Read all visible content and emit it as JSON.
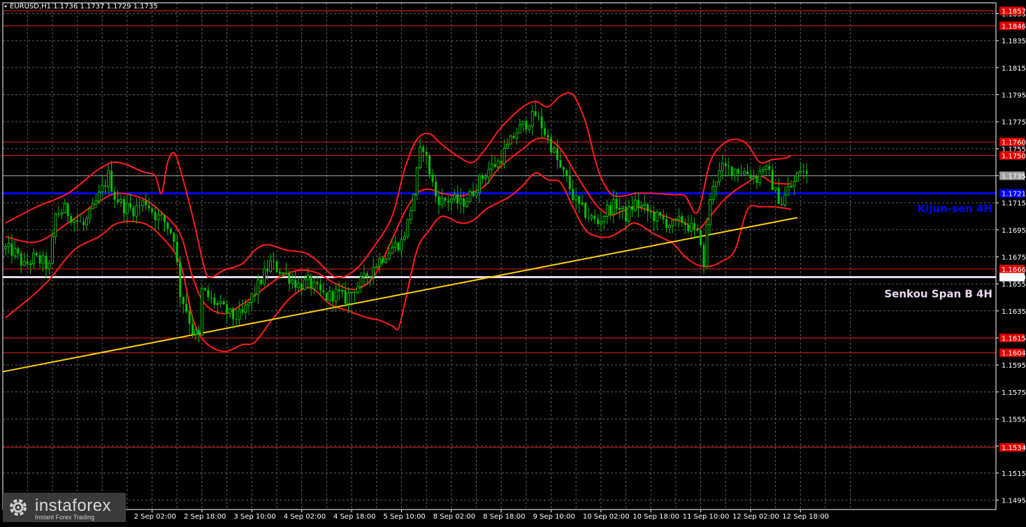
{
  "header": {
    "symbol_line": "EURUSD,H1  1.1736 1.1737 1.1729 1.1735"
  },
  "colors": {
    "background": "#000000",
    "grid": "#606060",
    "candle": "#00c000",
    "level_red": "#e02020",
    "kijun": "#0000ff",
    "senkou": "#e8d8f0",
    "trend": "#ffd000",
    "bands": "#ff1c1c",
    "badge": "#e00000",
    "badge_blue": "#0000ff",
    "badge_gray": "#a0a0a0"
  },
  "logo": {
    "name": "instaforex",
    "tagline": "Instant Forex Trading",
    "icon": "gear-icon"
  },
  "chart_data": {
    "type": "candlestick",
    "symbol": "EURUSD",
    "timeframe": "H1",
    "ohlc_current": {
      "open": 1.1736,
      "high": 1.1737,
      "low": 1.1729,
      "close": 1.1735
    },
    "ylim": [
      1.1488,
      1.1863
    ],
    "y_ticks": [
      "1.1855",
      "1.1835",
      "1.1815",
      "1.1795",
      "1.1775",
      "1.1755",
      "1.1735",
      "1.1715",
      "1.1695",
      "1.1675",
      "1.1655",
      "1.1635",
      "1.1615",
      "1.1595",
      "1.1575",
      "1.1555",
      "1.1535",
      "1.1515",
      "1.1495"
    ],
    "x_ticks": [
      {
        "label": "2 Sep 02:00",
        "bar": 47
      },
      {
        "label": "2 Sep 18:00",
        "bar": 63
      },
      {
        "label": "3 Sep 10:00",
        "bar": 79
      },
      {
        "label": "4 Sep 02:00",
        "bar": 95
      },
      {
        "label": "4 Sep 18:00",
        "bar": 111
      },
      {
        "label": "5 Sep 10:00",
        "bar": 127
      },
      {
        "label": "8 Sep 02:00",
        "bar": 143
      },
      {
        "label": "8 Sep 18:00",
        "bar": 159
      },
      {
        "label": "9 Sep 10:00",
        "bar": 175
      },
      {
        "label": "10 Sep 02:00",
        "bar": 191
      },
      {
        "label": "10 Sep 18:00",
        "bar": 207
      },
      {
        "label": "11 Sep 10:00",
        "bar": 223
      },
      {
        "label": "12 Sep 02:00",
        "bar": 239
      },
      {
        "label": "12 Sep 18:00",
        "bar": 255
      }
    ],
    "bar_count": 258,
    "close_path": [
      [
        0,
        1.1681
      ],
      [
        3,
        1.1678
      ],
      [
        6,
        1.1668
      ],
      [
        9,
        1.1674
      ],
      [
        12,
        1.1671
      ],
      [
        14,
        1.1667
      ],
      [
        16,
        1.1706
      ],
      [
        19,
        1.171
      ],
      [
        22,
        1.1703
      ],
      [
        25,
        1.1698
      ],
      [
        28,
        1.171
      ],
      [
        31,
        1.1725
      ],
      [
        33,
        1.1735
      ],
      [
        35,
        1.172
      ],
      [
        38,
        1.1712
      ],
      [
        41,
        1.171
      ],
      [
        45,
        1.1716
      ],
      [
        48,
        1.1706
      ],
      [
        51,
        1.1701
      ],
      [
        54,
        1.169
      ],
      [
        56,
        1.1648
      ],
      [
        58,
        1.1636
      ],
      [
        60,
        1.162
      ],
      [
        62,
        1.1615
      ],
      [
        63,
        1.165
      ],
      [
        66,
        1.1643
      ],
      [
        70,
        1.1636
      ],
      [
        73,
        1.163
      ],
      [
        76,
        1.1632
      ],
      [
        79,
        1.1645
      ],
      [
        82,
        1.1658
      ],
      [
        85,
        1.167
      ],
      [
        88,
        1.1665
      ],
      [
        91,
        1.166
      ],
      [
        94,
        1.1654
      ],
      [
        97,
        1.1656
      ],
      [
        100,
        1.165
      ],
      [
        103,
        1.1645
      ],
      [
        106,
        1.1648
      ],
      [
        109,
        1.1644
      ],
      [
        112,
        1.1652
      ],
      [
        115,
        1.1658
      ],
      [
        118,
        1.1668
      ],
      [
        121,
        1.1675
      ],
      [
        124,
        1.1682
      ],
      [
        127,
        1.1686
      ],
      [
        129,
        1.17
      ],
      [
        131,
        1.1722
      ],
      [
        133,
        1.1752
      ],
      [
        134,
        1.1757
      ],
      [
        136,
        1.1738
      ],
      [
        138,
        1.172
      ],
      [
        140,
        1.1716
      ],
      [
        143,
        1.1718
      ],
      [
        146,
        1.1714
      ],
      [
        149,
        1.172
      ],
      [
        152,
        1.1731
      ],
      [
        155,
        1.174
      ],
      [
        158,
        1.1745
      ],
      [
        161,
        1.1756
      ],
      [
        164,
        1.1768
      ],
      [
        167,
        1.1774
      ],
      [
        170,
        1.178
      ],
      [
        172,
        1.1772
      ],
      [
        174,
        1.1762
      ],
      [
        176,
        1.1752
      ],
      [
        178,
        1.174
      ],
      [
        180,
        1.1732
      ],
      [
        182,
        1.172
      ],
      [
        184,
        1.1712
      ],
      [
        187,
        1.1705
      ],
      [
        190,
        1.17
      ],
      [
        193,
        1.171
      ],
      [
        196,
        1.1714
      ],
      [
        199,
        1.1705
      ],
      [
        202,
        1.1715
      ],
      [
        205,
        1.171
      ],
      [
        208,
        1.1705
      ],
      [
        211,
        1.1702
      ],
      [
        214,
        1.1698
      ],
      [
        217,
        1.1702
      ],
      [
        220,
        1.1696
      ],
      [
        223,
        1.1688
      ],
      [
        224,
        1.1665
      ],
      [
        225,
        1.17
      ],
      [
        227,
        1.173
      ],
      [
        230,
        1.174
      ],
      [
        234,
        1.174
      ],
      [
        238,
        1.1737
      ],
      [
        241,
        1.1733
      ],
      [
        243,
        1.1742
      ],
      [
        245,
        1.1735
      ],
      [
        247,
        1.1722
      ],
      [
        249,
        1.1715
      ],
      [
        251,
        1.1725
      ],
      [
        253,
        1.173
      ],
      [
        255,
        1.174
      ],
      [
        257,
        1.1735
      ]
    ],
    "levels": [
      {
        "value": 1.1857,
        "label": "1.1857"
      },
      {
        "value": 1.1846,
        "label": "1.1846"
      },
      {
        "value": 1.176,
        "label": "1.1760"
      },
      {
        "value": 1.175,
        "label": "1.1750"
      },
      {
        "value": 1.1666,
        "label": "1.1666"
      },
      {
        "value": 1.1615,
        "label": "1.1615"
      },
      {
        "value": 1.1604,
        "label": "1.1604"
      },
      {
        "value": 1.1534,
        "label": "1.1534"
      }
    ],
    "kijun": {
      "value": 1.1722,
      "label": "1.1721",
      "name": "Kijun-sen 4H"
    },
    "senkou": {
      "value": 1.166,
      "label": "1.1660",
      "name": "Senkou Span B 4H"
    },
    "current_price": {
      "value": 1.1735,
      "label": "1.1735"
    },
    "trend_line": {
      "from": [
        0,
        1.159
      ],
      "to": [
        254,
        1.1704
      ]
    },
    "bollinger_upper": [
      [
        0,
        1.17
      ],
      [
        10,
        1.1712
      ],
      [
        20,
        1.1722
      ],
      [
        30,
        1.174
      ],
      [
        36,
        1.1745
      ],
      [
        44,
        1.1738
      ],
      [
        48,
        1.1735
      ],
      [
        50,
        1.1722
      ],
      [
        52,
        1.1745
      ],
      [
        54,
        1.1752
      ],
      [
        56,
        1.174
      ],
      [
        60,
        1.1705
      ],
      [
        64,
        1.1665
      ],
      [
        66,
        1.166
      ],
      [
        70,
        1.1665
      ],
      [
        76,
        1.167
      ],
      [
        80,
        1.168
      ],
      [
        84,
        1.1684
      ],
      [
        90,
        1.168
      ],
      [
        96,
        1.1678
      ],
      [
        100,
        1.1672
      ],
      [
        106,
        1.166
      ],
      [
        112,
        1.1665
      ],
      [
        118,
        1.1682
      ],
      [
        124,
        1.1705
      ],
      [
        128,
        1.174
      ],
      [
        132,
        1.1762
      ],
      [
        136,
        1.1766
      ],
      [
        140,
        1.1758
      ],
      [
        146,
        1.1748
      ],
      [
        150,
        1.1745
      ],
      [
        154,
        1.1755
      ],
      [
        158,
        1.1768
      ],
      [
        162,
        1.1778
      ],
      [
        166,
        1.1786
      ],
      [
        170,
        1.179
      ],
      [
        174,
        1.1786
      ],
      [
        178,
        1.1794
      ],
      [
        182,
        1.1795
      ],
      [
        186,
        1.1775
      ],
      [
        190,
        1.174
      ],
      [
        194,
        1.1722
      ],
      [
        198,
        1.172
      ],
      [
        202,
        1.1722
      ],
      [
        208,
        1.1722
      ],
      [
        214,
        1.1721
      ],
      [
        218,
        1.172
      ],
      [
        222,
        1.1708
      ],
      [
        226,
        1.1745
      ],
      [
        230,
        1.1758
      ],
      [
        234,
        1.1762
      ],
      [
        238,
        1.1758
      ],
      [
        242,
        1.1745
      ],
      [
        246,
        1.1747
      ],
      [
        250,
        1.1748
      ],
      [
        252,
        1.175
      ]
    ],
    "bollinger_middle": [
      [
        0,
        1.169
      ],
      [
        10,
        1.1686
      ],
      [
        20,
        1.17
      ],
      [
        30,
        1.1716
      ],
      [
        36,
        1.1722
      ],
      [
        44,
        1.1718
      ],
      [
        50,
        1.1708
      ],
      [
        56,
        1.1692
      ],
      [
        60,
        1.166
      ],
      [
        64,
        1.164
      ],
      [
        70,
        1.1633
      ],
      [
        76,
        1.164
      ],
      [
        82,
        1.165
      ],
      [
        88,
        1.166
      ],
      [
        94,
        1.1665
      ],
      [
        100,
        1.1663
      ],
      [
        106,
        1.1655
      ],
      [
        112,
        1.1651
      ],
      [
        118,
        1.166
      ],
      [
        124,
        1.1688
      ],
      [
        128,
        1.1708
      ],
      [
        132,
        1.1722
      ],
      [
        136,
        1.1725
      ],
      [
        140,
        1.1722
      ],
      [
        146,
        1.172
      ],
      [
        150,
        1.1723
      ],
      [
        154,
        1.1728
      ],
      [
        158,
        1.174
      ],
      [
        162,
        1.1748
      ],
      [
        166,
        1.1755
      ],
      [
        170,
        1.1762
      ],
      [
        174,
        1.1762
      ],
      [
        178,
        1.1755
      ],
      [
        182,
        1.174
      ],
      [
        186,
        1.1725
      ],
      [
        190,
        1.1712
      ],
      [
        194,
        1.1706
      ],
      [
        198,
        1.1709
      ],
      [
        202,
        1.1712
      ],
      [
        208,
        1.1708
      ],
      [
        214,
        1.1703
      ],
      [
        218,
        1.17
      ],
      [
        222,
        1.1695
      ],
      [
        226,
        1.1705
      ],
      [
        230,
        1.1716
      ],
      [
        234,
        1.1724
      ],
      [
        238,
        1.173
      ],
      [
        242,
        1.1735
      ],
      [
        246,
        1.173
      ],
      [
        250,
        1.1729
      ],
      [
        252,
        1.1729
      ]
    ],
    "bollinger_lower": [
      [
        0,
        1.163
      ],
      [
        8,
        1.1645
      ],
      [
        14,
        1.1658
      ],
      [
        22,
        1.168
      ],
      [
        30,
        1.169
      ],
      [
        36,
        1.17
      ],
      [
        44,
        1.17
      ],
      [
        50,
        1.169
      ],
      [
        56,
        1.167
      ],
      [
        60,
        1.163
      ],
      [
        64,
        1.1612
      ],
      [
        70,
        1.1605
      ],
      [
        76,
        1.161
      ],
      [
        80,
        1.1612
      ],
      [
        86,
        1.163
      ],
      [
        92,
        1.1646
      ],
      [
        98,
        1.1652
      ],
      [
        104,
        1.164
      ],
      [
        110,
        1.1635
      ],
      [
        116,
        1.163
      ],
      [
        120,
        1.1628
      ],
      [
        124,
        1.1624
      ],
      [
        126,
        1.1622
      ],
      [
        128,
        1.164
      ],
      [
        132,
        1.168
      ],
      [
        136,
        1.1695
      ],
      [
        140,
        1.1705
      ],
      [
        146,
        1.17
      ],
      [
        150,
        1.1702
      ],
      [
        154,
        1.171
      ],
      [
        158,
        1.1715
      ],
      [
        162,
        1.172
      ],
      [
        166,
        1.1728
      ],
      [
        170,
        1.1737
      ],
      [
        174,
        1.1732
      ],
      [
        178,
        1.173
      ],
      [
        182,
        1.1712
      ],
      [
        186,
        1.1695
      ],
      [
        190,
        1.169
      ],
      [
        194,
        1.169
      ],
      [
        198,
        1.1695
      ],
      [
        202,
        1.17
      ],
      [
        208,
        1.1692
      ],
      [
        214,
        1.1685
      ],
      [
        218,
        1.1675
      ],
      [
        222,
        1.1669
      ],
      [
        226,
        1.1668
      ],
      [
        230,
        1.1672
      ],
      [
        234,
        1.168
      ],
      [
        238,
        1.171
      ],
      [
        242,
        1.1712
      ],
      [
        246,
        1.1712
      ],
      [
        250,
        1.1711
      ],
      [
        252,
        1.171
      ]
    ]
  }
}
